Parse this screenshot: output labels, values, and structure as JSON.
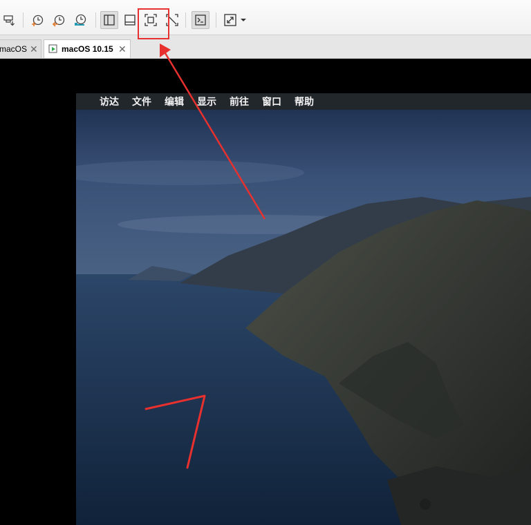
{
  "tabs": [
    {
      "label": "macOS",
      "active": false
    },
    {
      "label": "macOS 10.15",
      "active": true
    }
  ],
  "menubar": {
    "items": [
      "访达",
      "文件",
      "编辑",
      "显示",
      "前往",
      "窗口",
      "帮助"
    ]
  },
  "colors": {
    "annotation": "#e8312f",
    "menubar_bg": "#22272c",
    "accent_orange": "#e07a2c",
    "accent_teal": "#1f9bb5"
  },
  "toolbar_icons": [
    "send-keys-icon",
    "snapshot-icon",
    "revert-snapshot-icon",
    "manage-snapshots-icon",
    "show-library-icon",
    "show-thumbnail-bar-icon",
    "full-screen-icon",
    "unity-icon",
    "console-view-icon",
    "stretch-guest-icon",
    "dropdown-arrow-icon"
  ]
}
